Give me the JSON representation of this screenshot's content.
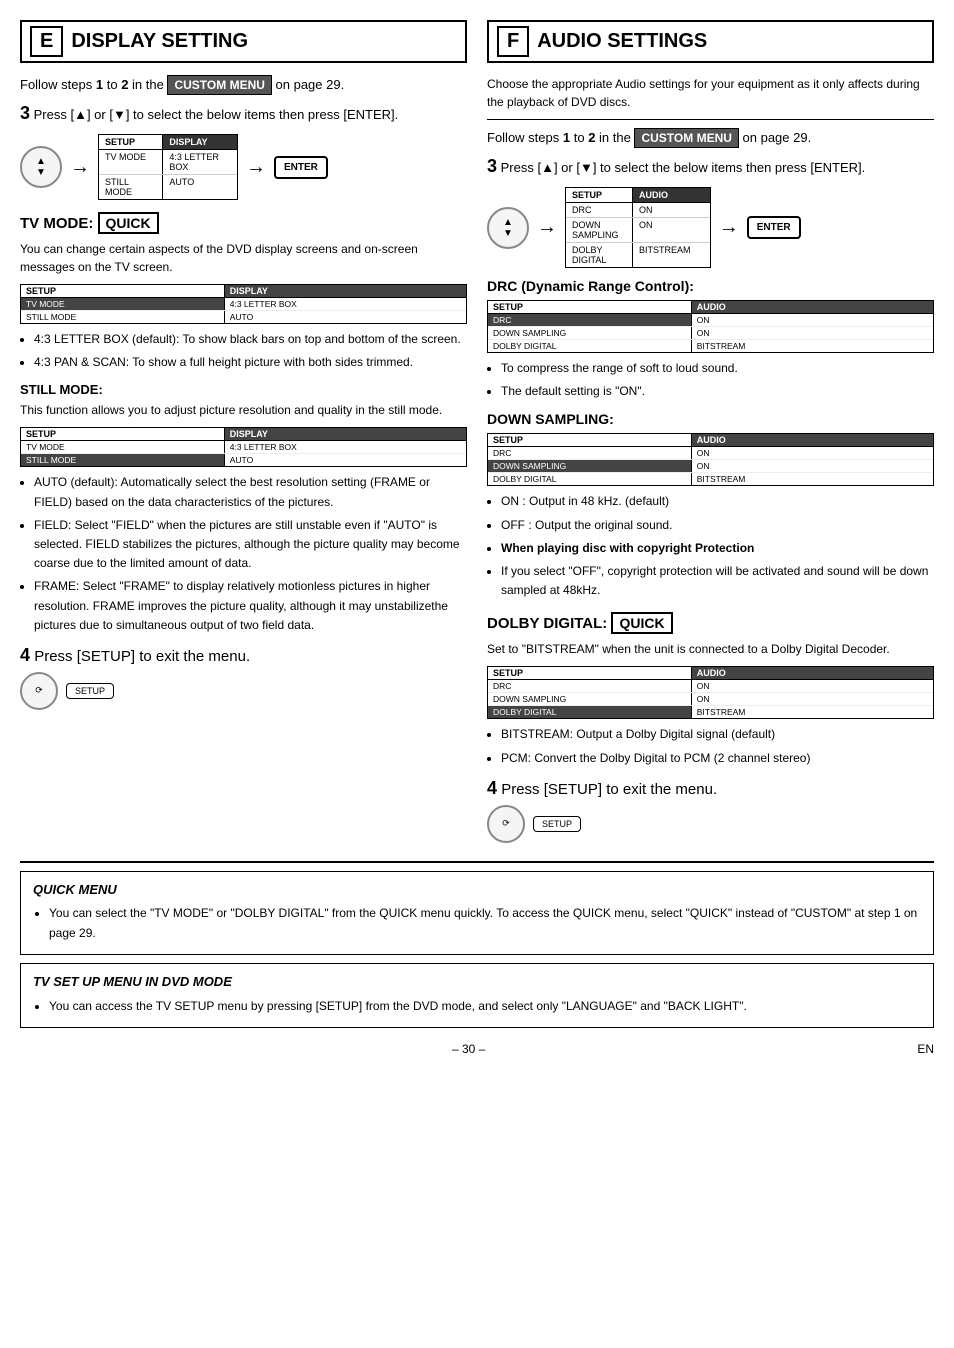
{
  "left": {
    "section_letter": "E",
    "section_title": "DISPLAY SETTING",
    "intro": {
      "prefix": "Follow steps ",
      "step1": "1",
      "to": " to ",
      "step2": "2",
      "suffix": " in the ",
      "custom_menu": "CUSTOM MENU",
      "postfix": " on page 29."
    },
    "step3": {
      "number": "3",
      "text": "Press [▲] or [▼] to select the below items then press [ENTER]."
    },
    "main_screen": {
      "tab1": "SETUP",
      "tab2": "DISPLAY",
      "rows": [
        {
          "label": "TV MODE",
          "value": "4:3 LETTER BOX",
          "highlighted": false
        },
        {
          "label": "STILL MODE",
          "value": "AUTO",
          "highlighted": false
        }
      ],
      "enter_label": "ENTER"
    },
    "tv_mode": {
      "title": "TV MODE: ",
      "quick_label": "QUICK",
      "desc": "You can change certain aspects of the DVD display screens and on-screen messages on the TV screen.",
      "screen": {
        "tab1": "SETUP",
        "tab2": "DISPLAY",
        "rows": [
          {
            "label": "TV MODE",
            "value": "4:3 LETTER BOX",
            "highlighted": true
          },
          {
            "label": "STILL MODE",
            "value": "AUTO",
            "highlighted": false
          }
        ]
      },
      "bullets": [
        "4:3 LETTER BOX (default): To show black bars on top and bottom of the screen.",
        "4:3 PAN & SCAN: To show a full height picture with both sides trimmed."
      ]
    },
    "still_mode": {
      "title": "STILL MODE:",
      "desc": "This function allows you to adjust picture resolution and quality in the still mode.",
      "screen": {
        "tab1": "SETUP",
        "tab2": "DISPLAY",
        "rows": [
          {
            "label": "TV MODE",
            "value": "4:3 LETTER BOX",
            "highlighted": false
          },
          {
            "label": "STILL MODE",
            "value": "AUTO",
            "highlighted": true
          }
        ]
      },
      "bullets": [
        "AUTO (default): Automatically select the best resolution setting (FRAME or FIELD) based on the data characteristics of the pictures.",
        "FIELD: Select \"FIELD\" when the pictures are still unstable even if \"AUTO\" is selected. FIELD stabilizes the pictures, although the picture quality may become coarse due to the limited amount of data.",
        "FRAME: Select \"FRAME\" to display relatively motionless pictures in higher resolution. FRAME improves the picture quality, although it may unstabilizethe pictures due to simultaneous output of two field data."
      ]
    },
    "step4": {
      "number": "4",
      "text": "Press [SETUP] to exit the menu."
    },
    "setup_btn": {
      "label": "SETUP"
    }
  },
  "right": {
    "section_letter": "F",
    "section_title": "AUDIO SETTINGS",
    "intro_desc": "Choose the appropriate Audio settings for your equipment as it only affects during the playback of DVD discs.",
    "intro": {
      "prefix": "Follow steps ",
      "step1": "1",
      "to": " to ",
      "step2": "2",
      "suffix": " in the ",
      "custom_menu": "CUSTOM MENU",
      "postfix": " on page 29."
    },
    "step3": {
      "number": "3",
      "text": "Press [▲] or [▼] to select the below items then press [ENTER]."
    },
    "main_screen": {
      "tab1": "SETUP",
      "tab2": "AUDIO",
      "rows": [
        {
          "label": "DRC",
          "value": "ON",
          "highlighted": false
        },
        {
          "label": "DOWN SAMPLING",
          "value": "ON",
          "highlighted": false
        },
        {
          "label": "DOLBY DIGITAL",
          "value": "BITSTREAM",
          "highlighted": false
        }
      ],
      "enter_label": "ENTER"
    },
    "drc": {
      "title": "DRC (Dynamic Range Control):",
      "screen": {
        "tab1": "SETUP",
        "tab2": "AUDIO",
        "rows": [
          {
            "label": "DRC",
            "value": "ON",
            "highlighted": true
          },
          {
            "label": "DOWN SAMPLING",
            "value": "ON",
            "highlighted": false
          },
          {
            "label": "DOLBY DIGITAL",
            "value": "BITSTREAM",
            "highlighted": false
          }
        ]
      },
      "bullets": [
        "To compress the range of soft to loud sound.",
        "The default setting is \"ON\"."
      ]
    },
    "down_sampling": {
      "title": "DOWN SAMPLING:",
      "screen": {
        "tab1": "SETUP",
        "tab2": "AUDIO",
        "rows": [
          {
            "label": "DRC",
            "value": "ON",
            "highlighted": false
          },
          {
            "label": "DOWN SAMPLING",
            "value": "ON",
            "highlighted": true
          },
          {
            "label": "DOLBY DIGITAL",
            "value": "BITSTREAM",
            "highlighted": false
          }
        ]
      },
      "bullets": [
        "ON : Output in 48 kHz. (default)",
        "OFF : Output the original sound.",
        "When playing disc with copyright Protection",
        "If you select \"OFF\", copyright protection will be activated and sound will be down sampled at 48kHz."
      ]
    },
    "dolby_digital": {
      "title": "DOLBY DIGITAL: ",
      "quick_label": "QUICK",
      "desc": "Set to \"BITSTREAM\" when the unit is connected to a Dolby Digital Decoder.",
      "screen": {
        "tab1": "SETUP",
        "tab2": "AUDIO",
        "rows": [
          {
            "label": "DRC",
            "value": "ON",
            "highlighted": false
          },
          {
            "label": "DOWN SAMPLING",
            "value": "ON",
            "highlighted": false
          },
          {
            "label": "DOLBY DIGITAL",
            "value": "BITSTREAM",
            "highlighted": true
          }
        ]
      },
      "bullets": [
        "BITSTREAM: Output a Dolby Digital signal (default)",
        "PCM: Convert the Dolby Digital to PCM (2 channel stereo)"
      ]
    },
    "step4": {
      "number": "4",
      "text": "Press [SETUP] to exit the menu."
    },
    "setup_btn": {
      "label": "SETUP"
    }
  },
  "bottom": {
    "quick_menu": {
      "title": "QUICK MENU",
      "text": "You can select the \"TV MODE\" or \"DOLBY DIGITAL\" from the QUICK menu quickly. To access the QUICK menu, select \"QUICK\" instead of \"CUSTOM\" at step 1 on page 29."
    },
    "tv_setup": {
      "title": "TV SET UP MENU IN DVD MODE",
      "text": "You can access the TV SETUP menu by pressing [SETUP] from the DVD mode, and select only \"LANGUAGE\" and \"BACK LIGHT\"."
    }
  },
  "footer": {
    "page": "– 30 –",
    "lang": "EN"
  }
}
